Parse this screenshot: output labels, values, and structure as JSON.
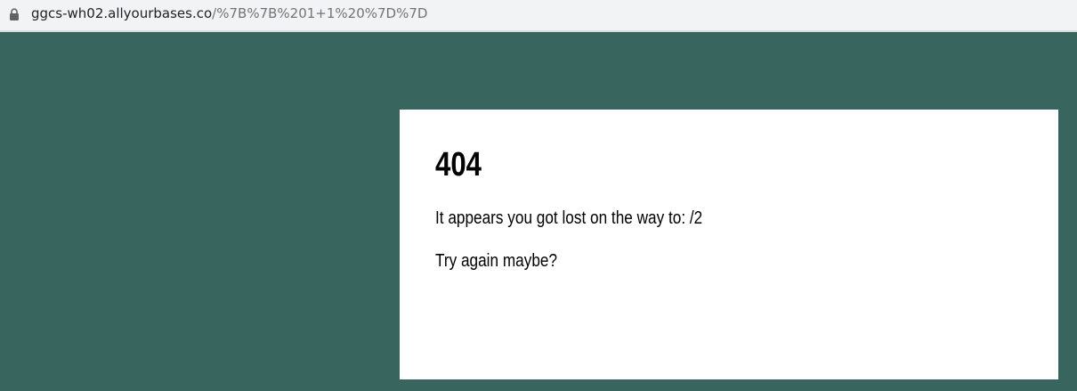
{
  "browser": {
    "url_host": "ggcs-wh02.allyourbases.co",
    "url_path": "/%7B%7B%201+1%20%7D%7D",
    "lock_icon": "lock-icon"
  },
  "page": {
    "background_color": "#38665e",
    "card": {
      "title": "404",
      "message": "It appears you got lost on the way to: /2",
      "hint": "Try again maybe?"
    }
  }
}
